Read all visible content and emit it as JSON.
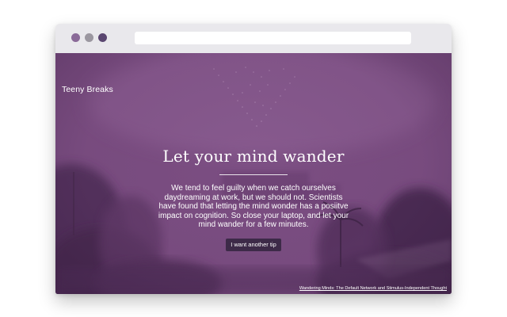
{
  "window": {
    "traffic_lights": [
      "close",
      "minimize",
      "maximize"
    ],
    "address_bar": ""
  },
  "page": {
    "brand": "Teeny Breaks",
    "headline": "Let your mind wander",
    "body": "We tend to feel guilty when we catch ourselves daydreaming at work, but we should not. Scientists have found that letting the mind wonder has a posiitve impact on cognition. So close your laptop, and let your mind wander for a few minutes.",
    "button_label": "I want another tip",
    "source_link": "Wandering Minds: The Default Network and Stimulus-Independent Thought"
  },
  "colors": {
    "overlay": "#7a4c80",
    "button": "#3d2a48",
    "chrome": "#e9e8ec"
  }
}
